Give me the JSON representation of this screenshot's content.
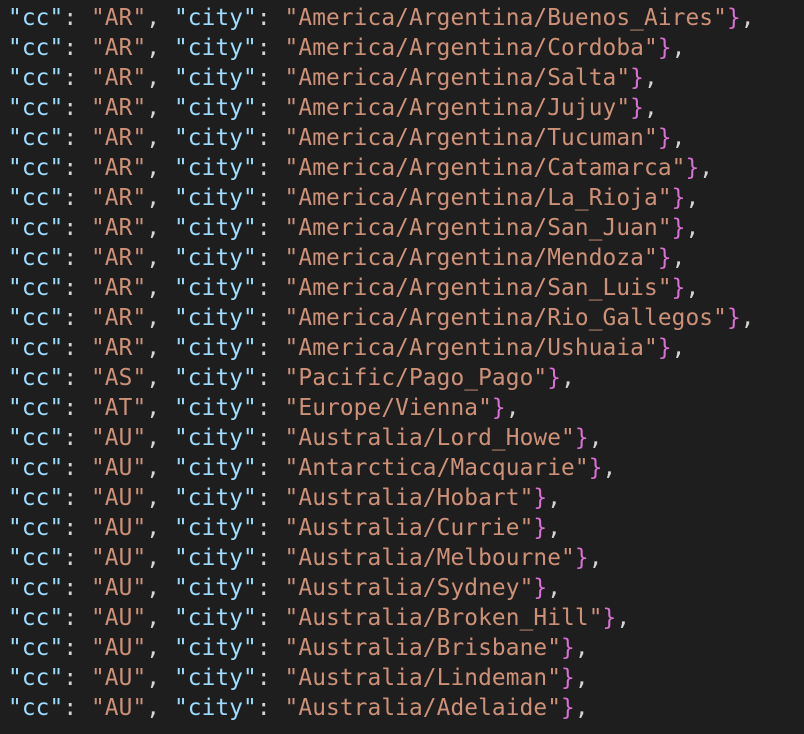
{
  "rows": [
    {
      "cc": "AR",
      "city": "America/Argentina/Buenos_Aires"
    },
    {
      "cc": "AR",
      "city": "America/Argentina/Cordoba"
    },
    {
      "cc": "AR",
      "city": "America/Argentina/Salta"
    },
    {
      "cc": "AR",
      "city": "America/Argentina/Jujuy"
    },
    {
      "cc": "AR",
      "city": "America/Argentina/Tucuman"
    },
    {
      "cc": "AR",
      "city": "America/Argentina/Catamarca"
    },
    {
      "cc": "AR",
      "city": "America/Argentina/La_Rioja"
    },
    {
      "cc": "AR",
      "city": "America/Argentina/San_Juan"
    },
    {
      "cc": "AR",
      "city": "America/Argentina/Mendoza"
    },
    {
      "cc": "AR",
      "city": "America/Argentina/San_Luis"
    },
    {
      "cc": "AR",
      "city": "America/Argentina/Rio_Gallegos"
    },
    {
      "cc": "AR",
      "city": "America/Argentina/Ushuaia"
    },
    {
      "cc": "AS",
      "city": "Pacific/Pago_Pago"
    },
    {
      "cc": "AT",
      "city": "Europe/Vienna"
    },
    {
      "cc": "AU",
      "city": "Australia/Lord_Howe"
    },
    {
      "cc": "AU",
      "city": "Antarctica/Macquarie"
    },
    {
      "cc": "AU",
      "city": "Australia/Hobart"
    },
    {
      "cc": "AU",
      "city": "Australia/Currie"
    },
    {
      "cc": "AU",
      "city": "Australia/Melbourne"
    },
    {
      "cc": "AU",
      "city": "Australia/Sydney"
    },
    {
      "cc": "AU",
      "city": "Australia/Broken_Hill"
    },
    {
      "cc": "AU",
      "city": "Australia/Brisbane"
    },
    {
      "cc": "AU",
      "city": "Australia/Lindeman"
    },
    {
      "cc": "AU",
      "city": "Australia/Adelaide"
    }
  ],
  "keys": {
    "cc": "cc",
    "city": "city"
  },
  "syntax": {
    "quote": "\"",
    "colon_after_key": ": ",
    "comma": ", ",
    "close_tail": "},",
    "key_open": "\"",
    "key_close": "\"",
    "val_open": "\"",
    "val_close": "\""
  }
}
